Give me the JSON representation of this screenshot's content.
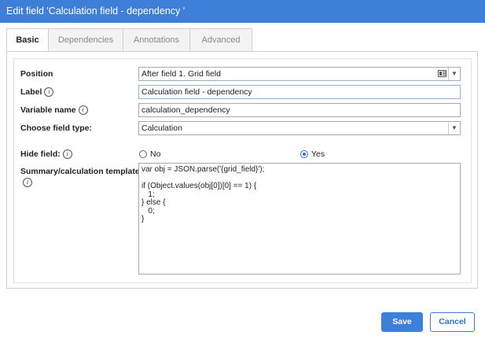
{
  "dialog": {
    "title": "Edit field 'Calculation field - dependency '"
  },
  "tabs": [
    {
      "label": "Basic",
      "active": true
    },
    {
      "label": "Dependencies",
      "active": false
    },
    {
      "label": "Annotations",
      "active": false
    },
    {
      "label": "Advanced",
      "active": false
    }
  ],
  "form": {
    "position": {
      "label": "Position",
      "value": "After field 1. Grid field"
    },
    "label": {
      "label": "Label",
      "value": "Calculation field - dependency"
    },
    "variable_name": {
      "label": "Variable name",
      "value": "calculation_dependency"
    },
    "field_type": {
      "label": "Choose field type:",
      "value": "Calculation"
    },
    "hide_field": {
      "label": "Hide field:",
      "options": [
        {
          "label": "No",
          "checked": false
        },
        {
          "label": "Yes",
          "checked": true
        }
      ]
    },
    "template": {
      "label": "Summary/calculation template",
      "value": "var obj = JSON.parse('{grid_field}');\n\nif (Object.values(obj[0])[0] == 1) {\n   1;\n} else {\n   0;\n}"
    },
    "info_glyph": "i"
  },
  "buttons": {
    "save": "Save",
    "cancel": "Cancel"
  },
  "colors": {
    "accent": "#3d7fd9"
  },
  "icons": [
    "info-icon",
    "list-icon",
    "chevron-down-icon"
  ]
}
